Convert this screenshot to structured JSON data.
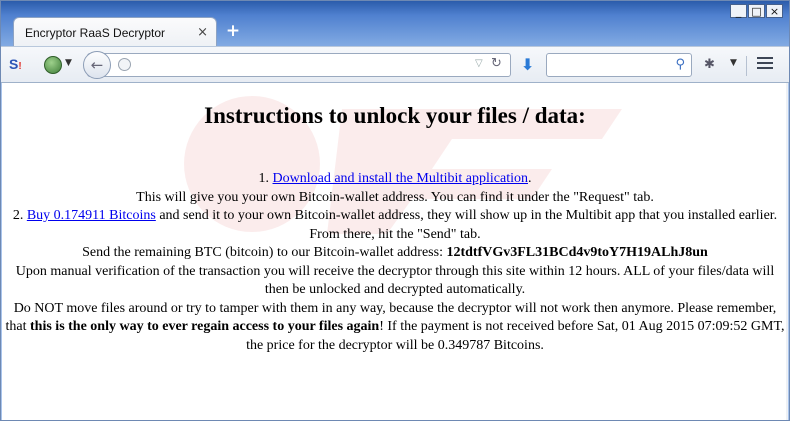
{
  "tab": {
    "title": "Encryptor RaaS Decryptor",
    "close": "×",
    "new_tab": "+"
  },
  "window_controls": {
    "minimize": "_",
    "maximize": "□",
    "close": "×"
  },
  "toolbar": {
    "url_value": "",
    "search_value": "",
    "icons": [
      "s-icon",
      "globe-icon",
      "back-icon",
      "reload-icon",
      "download-icon",
      "search-icon",
      "extension-icon",
      "menu-icon"
    ]
  },
  "page": {
    "heading": "Instructions to unlock your files / data:",
    "step1_prefix": "1. ",
    "step1_link": "Download and install the Multibit application",
    "step1_suffix": ".",
    "step1_detail": "This will give you your own Bitcoin-wallet address. You can find it under the \"Request\" tab.",
    "step2_prefix": "2. ",
    "step2_link": "Buy 0.174911 Bitcoins",
    "step2_suffix": " and send it to your own Bitcoin-wallet address, they will show up in the Multibit app that you installed earlier. From there, hit the \"Send\" tab.",
    "send_text": "Send the remaining BTC (bitcoin) to our Bitcoin-wallet address: ",
    "wallet_address": "12tdtfVGv3FL31BCd4v9toY7H19ALhJ8un",
    "verification_text": "Upon manual verification of the transaction you will receive the decryptor through this site within 12 hours. ALL of your files/data will then be unlocked and decrypted automatically.",
    "warning_text_1": "Do NOT move files around or try to tamper with them in any way, because the decryptor will not work then anymore. Please remember, that ",
    "warning_bold": "this is the only way to ever regain access to your files again",
    "warning_text_2": "! If the payment is not received before Sat, 01 Aug 2015 07:09:52 GMT, the price for the decryptor will be 0.349787 Bitcoins."
  },
  "colors": {
    "link": "#0000ee",
    "titlebar": "#4f80cf"
  }
}
